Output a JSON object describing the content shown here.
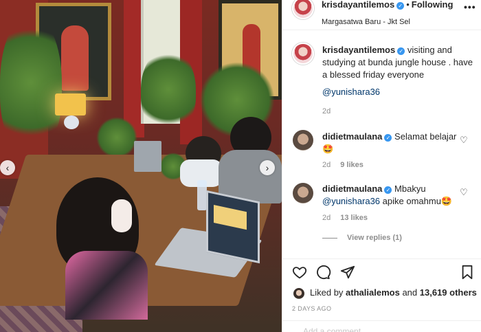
{
  "post": {
    "account": {
      "username": "krisdayantilemos",
      "follow_label": "Following",
      "location": "Margasatwa Baru - Jkt Sel"
    },
    "caption": {
      "username": "krisdayantilemos",
      "text": "visiting and studying at bunda jungle house . have a blessed friday everyone",
      "mention": "@yunishara36",
      "time": "2d"
    },
    "comments": [
      {
        "username": "didietmaulana",
        "text": "Selamat belajar 🤩",
        "time": "2d",
        "likes": "9 likes"
      },
      {
        "username": "didietmaulana",
        "text_before": "Mbakyu",
        "mention": "@yunishara36",
        "text_after": "apike omahmu🤩",
        "time": "2d",
        "likes": "13 likes"
      }
    ],
    "view_replies": "View replies (1)",
    "liked_by": {
      "prefix": "Liked by",
      "user": "athalialemos",
      "mid": "and",
      "count": "13,619 others"
    },
    "timestamp": "2 DAYS AGO",
    "add_comment_placeholder": "Add a comment..."
  },
  "icons": {
    "more": "more-options-icon",
    "like": "heart-icon",
    "comment": "comment-icon",
    "share": "paper-plane-icon",
    "save": "bookmark-icon"
  },
  "colors": {
    "verified": "#3897f0",
    "mention": "#00376b",
    "meta": "#8e8e8e"
  }
}
